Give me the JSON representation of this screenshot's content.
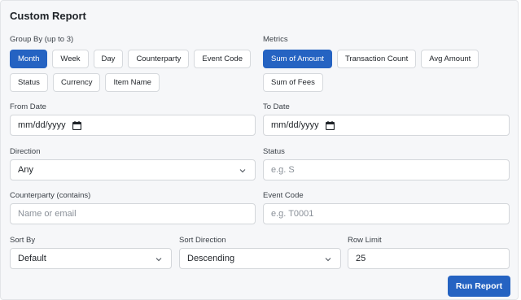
{
  "title": "Custom Report",
  "group_by": {
    "label": "Group By (up to 3)",
    "options": [
      {
        "label": "Month",
        "active": true
      },
      {
        "label": "Week",
        "active": false
      },
      {
        "label": "Day",
        "active": false
      },
      {
        "label": "Counterparty",
        "active": false
      },
      {
        "label": "Event Code",
        "active": false
      },
      {
        "label": "Status",
        "active": false
      },
      {
        "label": "Currency",
        "active": false
      },
      {
        "label": "Item Name",
        "active": false
      }
    ]
  },
  "metrics": {
    "label": "Metrics",
    "options": [
      {
        "label": "Sum of Amount",
        "active": true
      },
      {
        "label": "Transaction Count",
        "active": false
      },
      {
        "label": "Avg Amount",
        "active": false
      },
      {
        "label": "Sum of Fees",
        "active": false
      }
    ]
  },
  "from_date": {
    "label": "From Date",
    "placeholder": "mm/dd/yyyy"
  },
  "to_date": {
    "label": "To Date",
    "placeholder": "mm/dd/yyyy"
  },
  "direction": {
    "label": "Direction",
    "value": "Any"
  },
  "status": {
    "label": "Status",
    "placeholder": "e.g. S"
  },
  "counterparty": {
    "label": "Counterparty (contains)",
    "placeholder": "Name or email"
  },
  "event_code": {
    "label": "Event Code",
    "placeholder": "e.g. T0001"
  },
  "sort_by": {
    "label": "Sort By",
    "value": "Default"
  },
  "sort_direction": {
    "label": "Sort Direction",
    "value": "Descending"
  },
  "row_limit": {
    "label": "Row Limit",
    "value": "25"
  },
  "run_button": "Run Report",
  "colors": {
    "accent": "#2563c2",
    "panel_bg": "#f6f7f9",
    "border": "#d3d6da"
  }
}
